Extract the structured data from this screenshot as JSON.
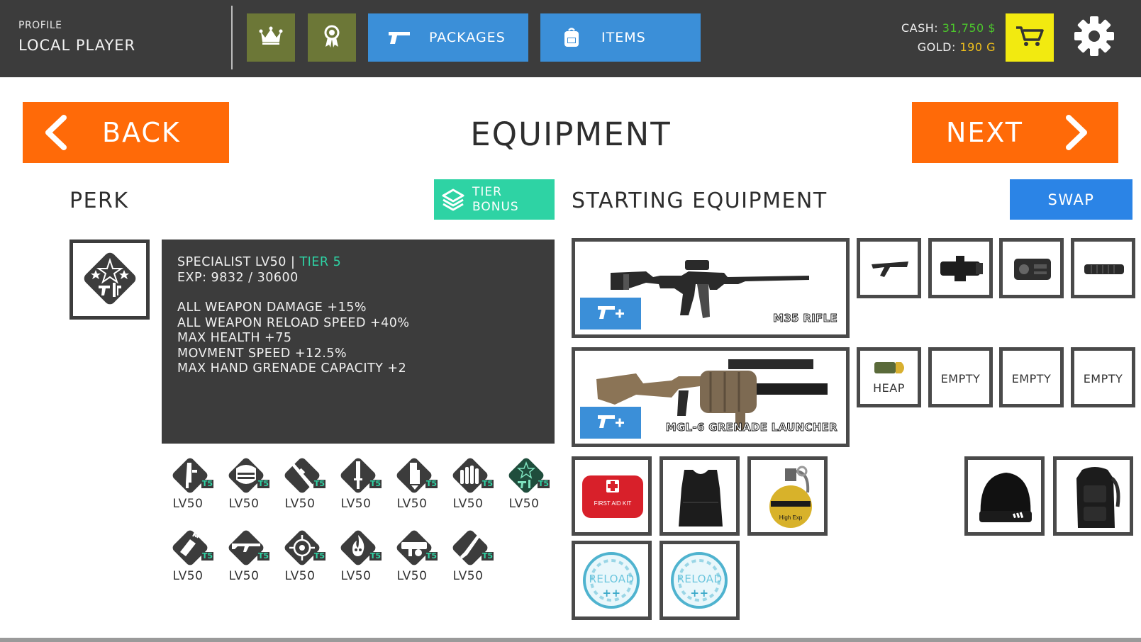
{
  "header": {
    "profile_label": "PROFILE",
    "player_name": "LOCAL PLAYER",
    "packages_label": "PACKAGES",
    "items_label": "ITEMS",
    "cash_label": "CASH:",
    "cash_value": "31,750 $",
    "gold_label": "GOLD:",
    "gold_value": "190 G",
    "icons": [
      "crown-icon",
      "award-ribbon-icon",
      "pistol-icon",
      "backpack-icon",
      "cart-icon",
      "gear-icon"
    ],
    "colors": {
      "bar": "#3c3c3c",
      "olive": "#6c7737",
      "blue": "#3b8fd8",
      "cart": "#f2ea10",
      "cash": "#4cc62c",
      "gold": "#f0c01c"
    }
  },
  "nav": {
    "back_label": "BACK",
    "next_label": "NEXT",
    "title": "EQUIPMENT",
    "accent": "#ff6a08"
  },
  "perk": {
    "section_title": "PERK",
    "tier_bonus_line1": "TIER",
    "tier_bonus_line2": "BONUS",
    "name": "SPECIALIST LV50",
    "separator": " | ",
    "tier": "TIER 5",
    "exp": "EXP: 9832 / 30600",
    "bonuses": [
      "ALL WEAPON DAMAGE +15%",
      "ALL WEAPON RELOAD SPEED +40%",
      "MAX HEALTH +75",
      "MOVMENT SPEED +12.5%",
      "MAX HAND GRENADE CAPACITY +2"
    ],
    "skills_row1": [
      {
        "icon": "pistol-perk-icon",
        "level": "LV50",
        "badge": "T5"
      },
      {
        "icon": "armor-perk-icon",
        "level": "LV50",
        "badge": "T5"
      },
      {
        "icon": "sniper-perk-icon",
        "level": "LV50",
        "badge": "T5"
      },
      {
        "icon": "knife-perk-icon",
        "level": "LV50",
        "badge": "T5"
      },
      {
        "icon": "medic-perk-icon",
        "level": "LV50",
        "badge": "T5"
      },
      {
        "icon": "ammo-perk-icon",
        "level": "LV50",
        "badge": "T5"
      },
      {
        "icon": "specialist-perk-icon",
        "level": "LV50",
        "badge": "T5"
      }
    ],
    "skills_row2": [
      {
        "icon": "explosive-perk-icon",
        "level": "LV50",
        "badge": "T5"
      },
      {
        "icon": "rifle-perk-icon",
        "level": "LV50",
        "badge": "T5"
      },
      {
        "icon": "crosshair-perk-icon",
        "level": "LV50",
        "badge": "T5"
      },
      {
        "icon": "fire-perk-icon",
        "level": "LV50",
        "badge": "T5"
      },
      {
        "icon": "heavy-weapon-perk-icon",
        "level": "LV50",
        "badge": "T5"
      },
      {
        "icon": "shotgun-perk-icon",
        "level": "LV50",
        "badge": "T5"
      }
    ]
  },
  "equipment": {
    "section_title": "STARTING EQUIPMENT",
    "swap_label": "SWAP",
    "primary_weapon": "M35 RIFLE",
    "secondary_weapon": "MGL-6 GRENADE LAUNCHER",
    "primary_attachments": [
      "foregrip-icon",
      "red-dot-sight-icon",
      "laser-module-icon",
      "suppressor-icon"
    ],
    "secondary_attachments": [
      {
        "icon": "grenade-round-icon",
        "label": "HEAP"
      },
      {
        "label": "EMPTY"
      },
      {
        "label": "EMPTY"
      },
      {
        "label": "EMPTY"
      }
    ],
    "items": [
      "first-aid-kit-icon",
      "body-armor-icon",
      "hand-grenade-icon"
    ],
    "first_aid_text": "FIRST AID KIT",
    "grenade_text": "High Exp",
    "reload_label": "RELOAD",
    "reload_plus": "++",
    "cosmetics": [
      "beanie-icon",
      "tactical-backpack-icon"
    ]
  }
}
